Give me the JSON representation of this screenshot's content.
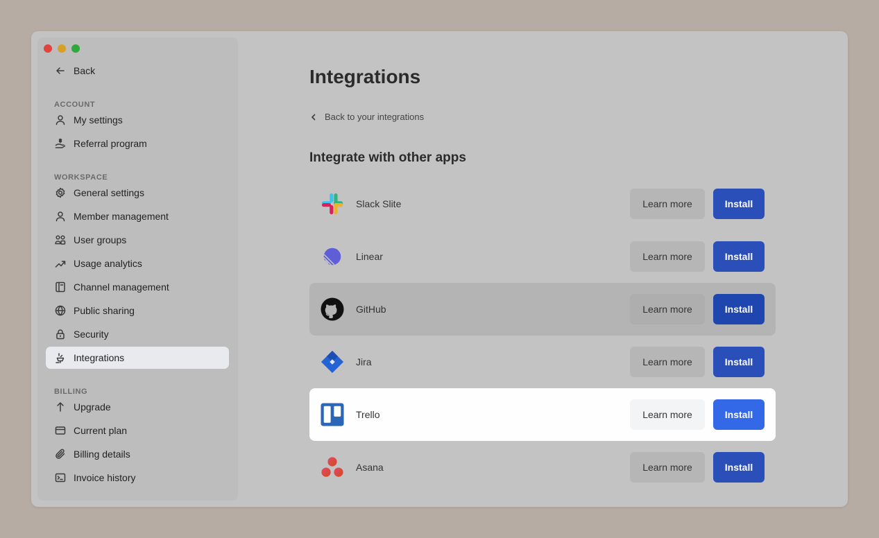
{
  "sidebar": {
    "back_label": "Back",
    "sections": {
      "account": "ACCOUNT",
      "workspace": "WORKSPACE",
      "billing": "BILLING"
    },
    "items": {
      "my_settings": "My settings",
      "referral_program": "Referral program",
      "general_settings": "General settings",
      "member_management": "Member management",
      "user_groups": "User groups",
      "usage_analytics": "Usage analytics",
      "channel_management": "Channel management",
      "public_sharing": "Public sharing",
      "security": "Security",
      "integrations": "Integrations",
      "upgrade": "Upgrade",
      "current_plan": "Current plan",
      "billing_details": "Billing details",
      "invoice_history": "Invoice history"
    },
    "active_item": "integrations"
  },
  "main": {
    "title": "Integrations",
    "back_link": "Back to your integrations",
    "section_title": "Integrate with other apps",
    "learn_more_label": "Learn more",
    "install_label": "Install",
    "integrations": [
      {
        "name": "Slack Slite",
        "icon": "slack-icon"
      },
      {
        "name": "Linear",
        "icon": "linear-icon"
      },
      {
        "name": "GitHub",
        "icon": "github-icon",
        "state": "hover"
      },
      {
        "name": "Jira",
        "icon": "jira-icon"
      },
      {
        "name": "Trello",
        "icon": "trello-icon",
        "state": "focused"
      },
      {
        "name": "Asana",
        "icon": "asana-icon"
      }
    ]
  },
  "colors": {
    "accent": "#2b4fb8",
    "accent_focused": "#3368e6",
    "background": "#c3c3c3",
    "desktop": "#b6aca3"
  }
}
